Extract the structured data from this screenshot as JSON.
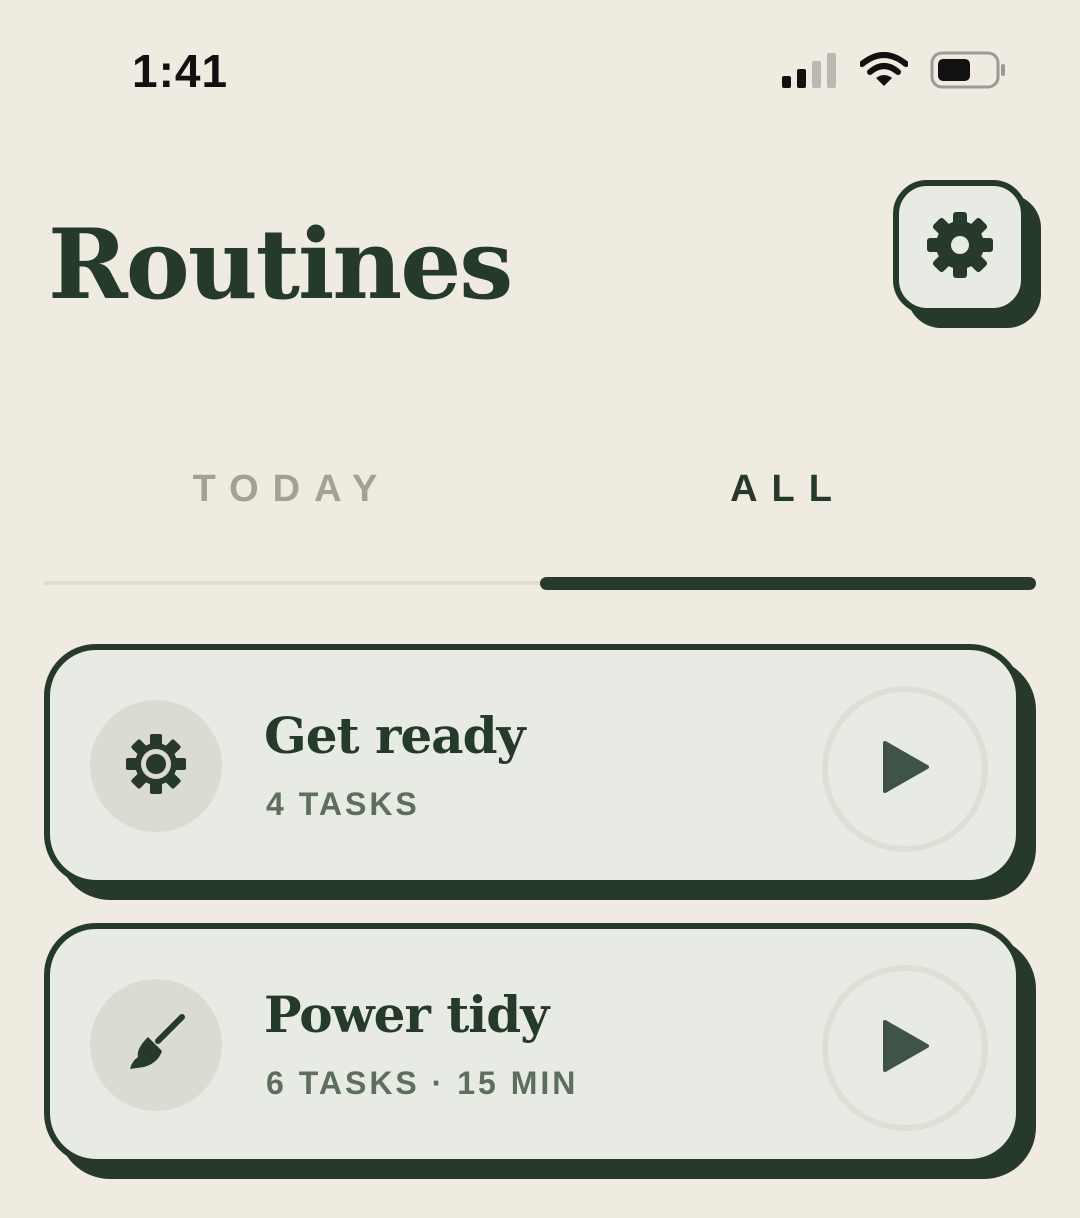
{
  "status_bar": {
    "time": "1:41",
    "icons": [
      "cellular-signal-icon",
      "wifi-icon",
      "battery-icon"
    ]
  },
  "header": {
    "title": "Routines",
    "settings_icon": "gear-icon"
  },
  "tabs": [
    {
      "label": "TODAY",
      "selected": false
    },
    {
      "label": "ALL",
      "selected": true
    }
  ],
  "routines": [
    {
      "title": "Get ready",
      "meta": "4 TASKS",
      "icon": "sun-icon",
      "action_icon": "play-icon"
    },
    {
      "title": "Power tidy",
      "meta": "6 TASKS · 15 MIN",
      "icon": "broom-icon",
      "action_icon": "play-icon"
    }
  ],
  "colors": {
    "background": "#efebe1",
    "ink": "#26392b",
    "card": "#e8ebe3",
    "muted_tab": "#a1a293",
    "meta_text": "#5d6e5f"
  }
}
